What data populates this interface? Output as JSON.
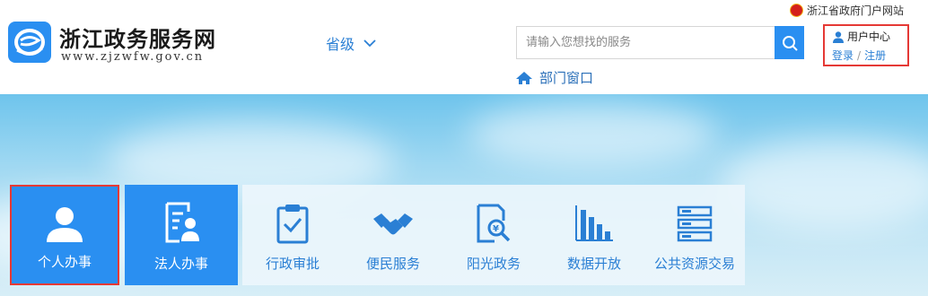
{
  "header": {
    "site_title": "浙江政务服务网",
    "site_url": "www.zjzwfw.gov.cn",
    "province_label": "省级",
    "gov_portal_link": "浙江省政府门户网站",
    "search_placeholder": "请输入您想找的服务",
    "dept_window_label": "部门窗口",
    "user_center": {
      "title": "用户中心",
      "login": "登录",
      "separator": "/",
      "register": "注册"
    }
  },
  "colors": {
    "primary": "#2a8ff1",
    "highlight_border": "#e53935",
    "link": "#2a7fd4"
  },
  "tiles": {
    "main": [
      {
        "label": "个人办事",
        "icon": "person-icon"
      },
      {
        "label": "法人办事",
        "icon": "corporate-id-icon"
      }
    ],
    "services": [
      {
        "label": "行政审批",
        "icon": "clipboard-check-icon"
      },
      {
        "label": "便民服务",
        "icon": "handshake-icon"
      },
      {
        "label": "阳光政务",
        "icon": "document-search-icon"
      },
      {
        "label": "数据开放",
        "icon": "bar-chart-icon"
      },
      {
        "label": "公共资源交易",
        "icon": "server-stack-icon"
      }
    ]
  }
}
